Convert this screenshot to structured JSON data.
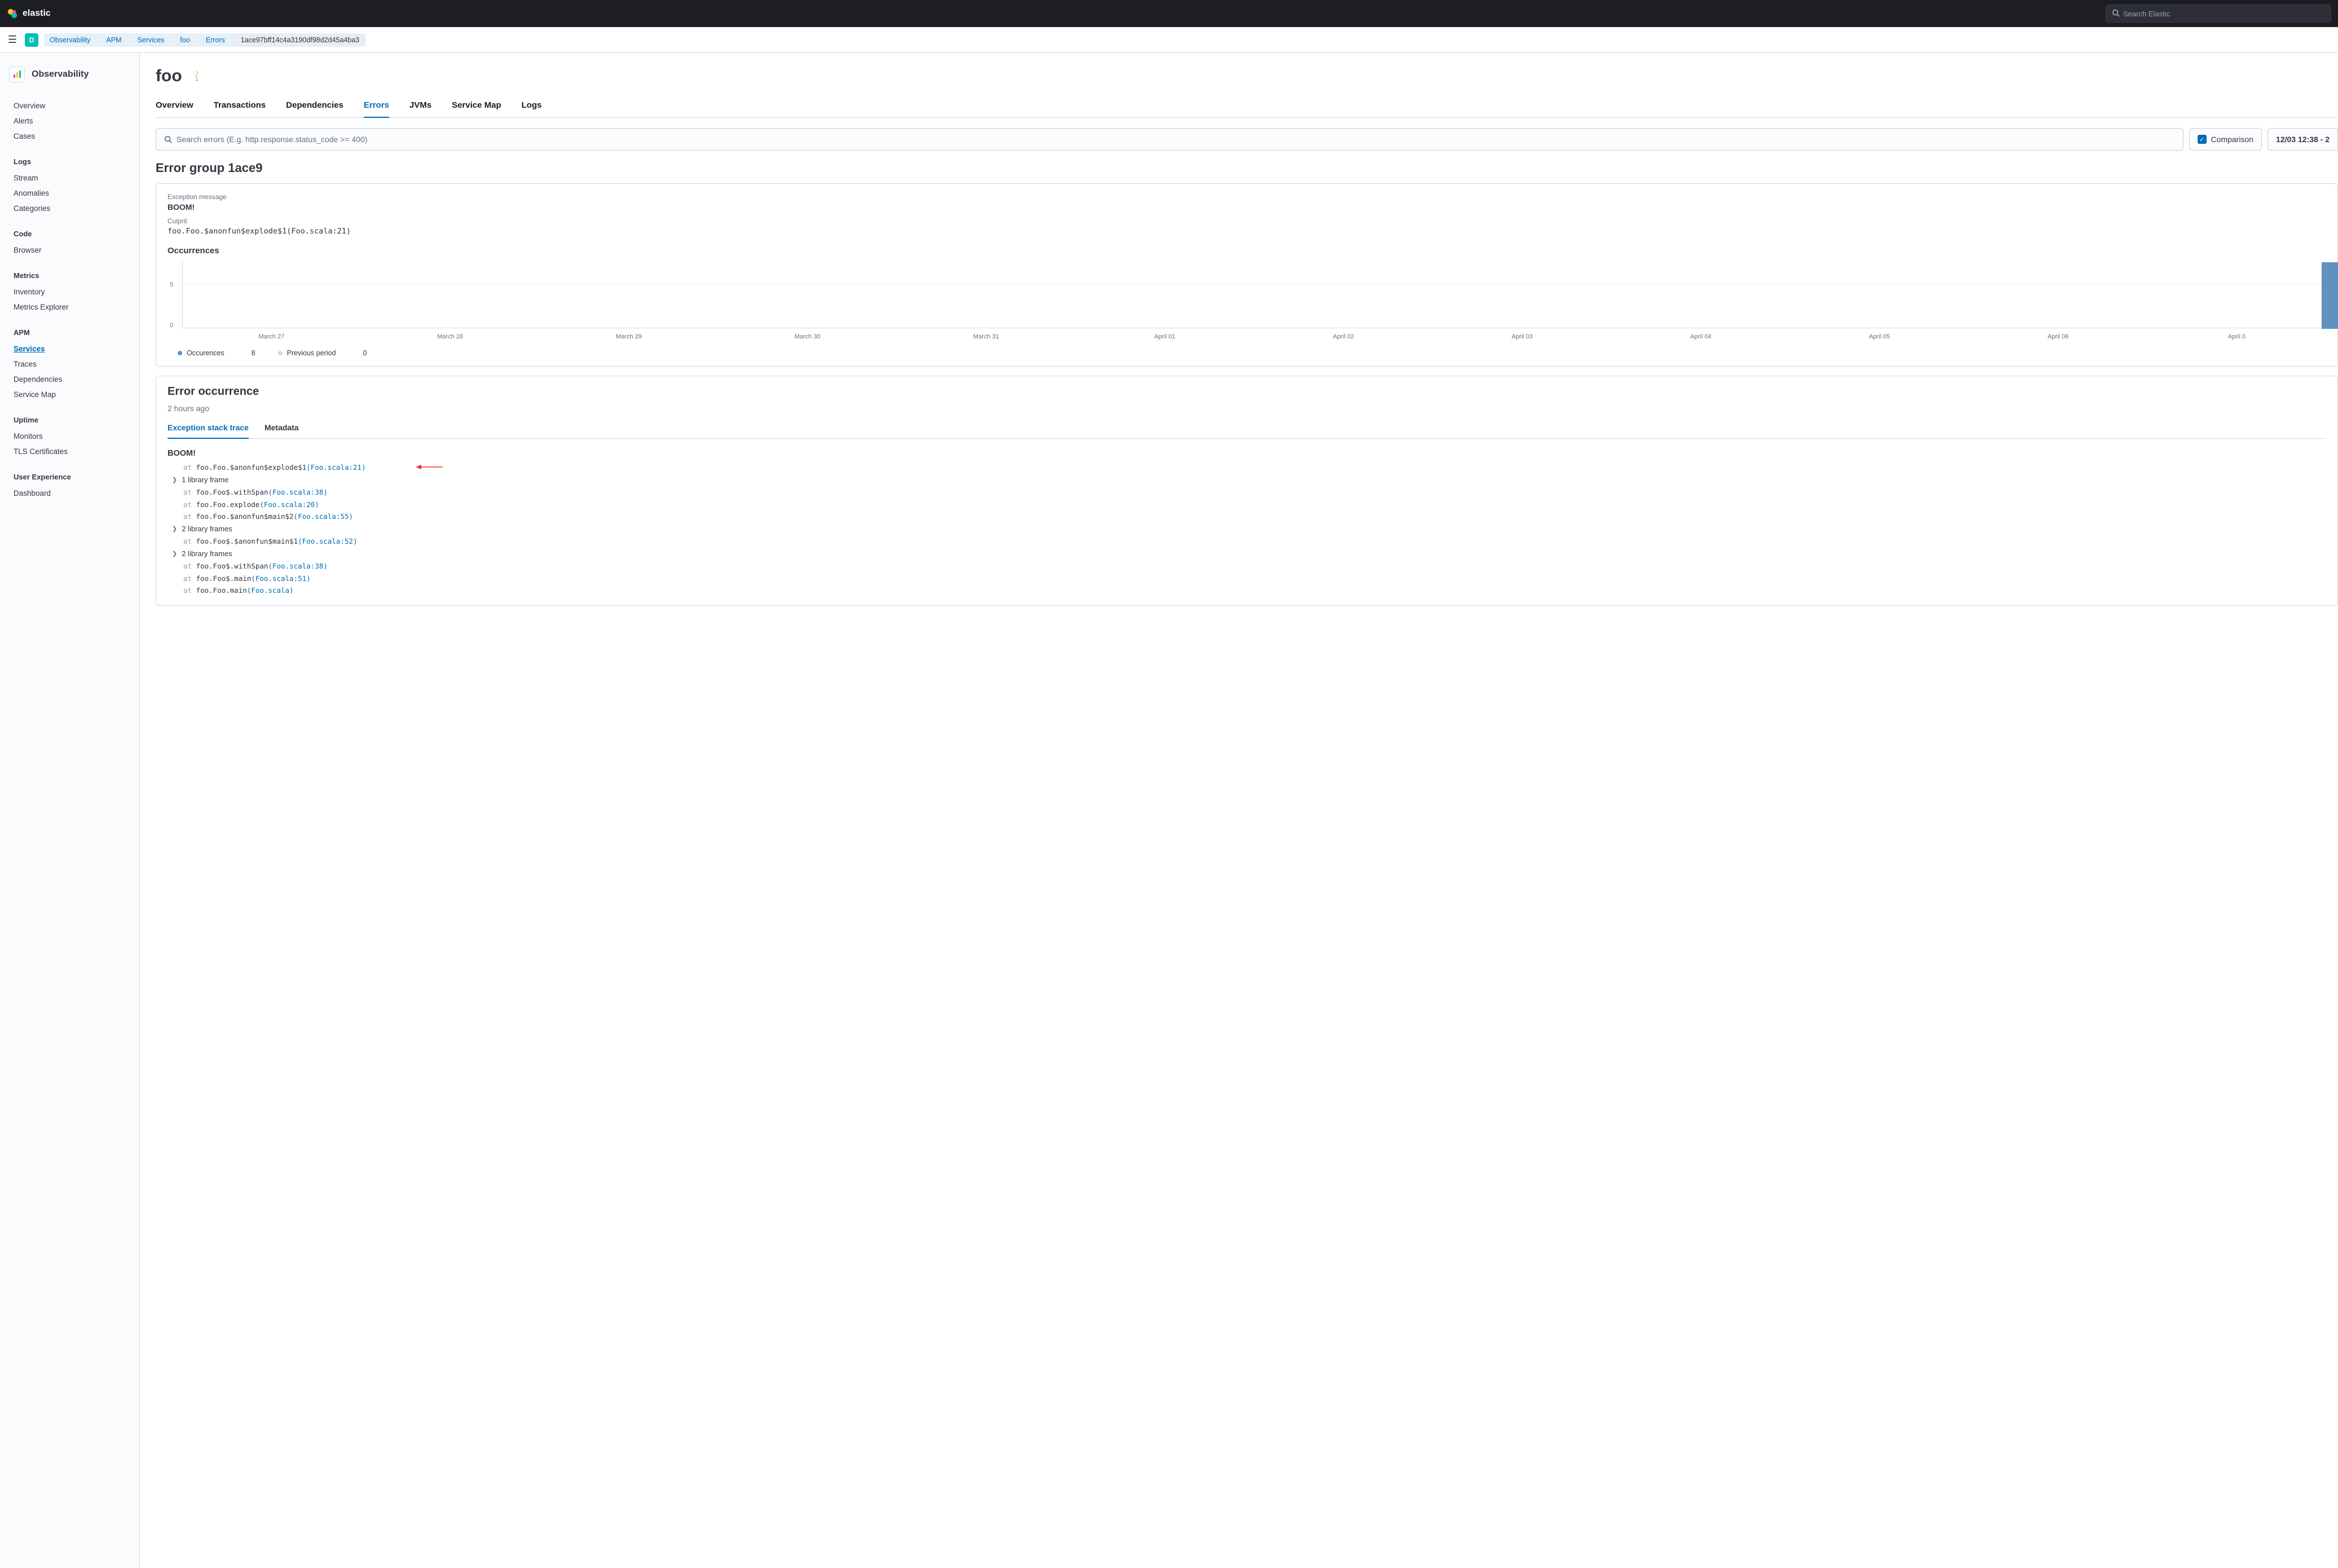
{
  "brand": "elastic",
  "global_search_placeholder": "Search Elastic",
  "avatar_letter": "D",
  "breadcrumbs": [
    "Observability",
    "APM",
    "Services",
    "foo",
    "Errors",
    "1ace97bff14c4a3190df98d2d45a4ba3"
  ],
  "sidebar": {
    "title": "Observability",
    "groups": [
      {
        "heading": null,
        "items": [
          "Overview",
          "Alerts",
          "Cases"
        ]
      },
      {
        "heading": "Logs",
        "items": [
          "Stream",
          "Anomalies",
          "Categories"
        ]
      },
      {
        "heading": "Code",
        "items": [
          "Browser"
        ]
      },
      {
        "heading": "Metrics",
        "items": [
          "Inventory",
          "Metrics Explorer"
        ]
      },
      {
        "heading": "APM",
        "items": [
          "Services",
          "Traces",
          "Dependencies",
          "Service Map"
        ]
      },
      {
        "heading": "Uptime",
        "items": [
          "Monitors",
          "TLS Certificates"
        ]
      },
      {
        "heading": "User Experience",
        "items": [
          "Dashboard"
        ]
      }
    ],
    "active_item": "Services"
  },
  "page": {
    "title": "foo",
    "tabs": [
      "Overview",
      "Transactions",
      "Dependencies",
      "Errors",
      "JVMs",
      "Service Map",
      "Logs"
    ],
    "active_tab": "Errors",
    "search_placeholder": "Search errors (E.g. http.response.status_code >= 400)",
    "comparison_label": "Comparison",
    "date_range": "12/03 12:38 - 2",
    "group_title": "Error group 1ace9",
    "exception_label": "Exception message",
    "exception_value": "BOOM!",
    "culprit_label": "Culprit",
    "culprit_value": "foo.Foo.$anonfun$explode$1(Foo.scala:21)",
    "occurrences_label": "Occurrences",
    "legend": {
      "occ": "Occurences",
      "occ_val": "8",
      "prev": "Previous period",
      "prev_val": "0"
    },
    "error_occurrence_title": "Error occurrence",
    "time_ago": "2 hours ago",
    "subtabs": [
      "Exception stack trace",
      "Metadata"
    ],
    "active_subtab": "Exception stack trace",
    "trace": {
      "title": "BOOM!",
      "lines": [
        {
          "type": "at",
          "txt": "foo.Foo.$anonfun$explode$1",
          "loc": "(Foo.scala:21)",
          "arrow": true
        },
        {
          "type": "coll",
          "txt": "1 library frame"
        },
        {
          "type": "at",
          "txt": "foo.Foo$.withSpan",
          "loc": "(Foo.scala:38)"
        },
        {
          "type": "at",
          "txt": "foo.Foo.explode",
          "loc": "(Foo.scala:20)"
        },
        {
          "type": "at",
          "txt": "foo.Foo.$anonfun$main$2",
          "loc": "(Foo.scala:55)"
        },
        {
          "type": "coll",
          "txt": "2 library frames"
        },
        {
          "type": "at",
          "txt": "foo.Foo$.$anonfun$main$1",
          "loc": "(Foo.scala:52)"
        },
        {
          "type": "coll",
          "txt": "2 library frames"
        },
        {
          "type": "at",
          "txt": "foo.Foo$.withSpan",
          "loc": "(Foo.scala:38)"
        },
        {
          "type": "at",
          "txt": "foo.Foo$.main",
          "loc": "(Foo.scala:51)"
        },
        {
          "type": "at",
          "txt": "foo.Foo.main",
          "loc": "(Foo.scala)"
        }
      ]
    }
  },
  "chart_data": {
    "type": "bar",
    "title": "Occurrences",
    "ylabel": "",
    "ylim": [
      0,
      8
    ],
    "yticks": [
      0,
      5
    ],
    "categories": [
      "March 27",
      "March 28",
      "March 29",
      "March 30",
      "March 31",
      "April 01",
      "April 02",
      "April 03",
      "April 04",
      "April 05",
      "April 06",
      "April 0"
    ],
    "series": [
      {
        "name": "Occurences",
        "color": "#6092c0",
        "values": [
          0,
          0,
          0,
          0,
          0,
          0,
          0,
          0,
          0,
          0,
          0,
          8
        ]
      },
      {
        "name": "Previous period",
        "color": "#d3dae6",
        "values": [
          0,
          0,
          0,
          0,
          0,
          0,
          0,
          0,
          0,
          0,
          0,
          0
        ]
      }
    ]
  }
}
